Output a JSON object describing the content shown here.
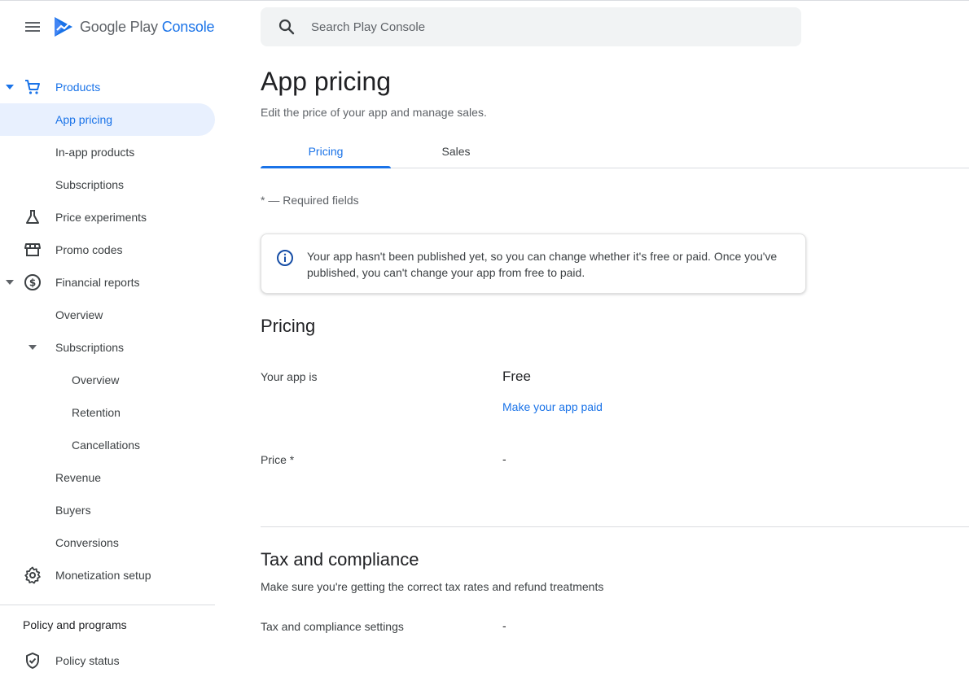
{
  "header": {
    "brand_google_play": "Google Play",
    "brand_console": "Console",
    "search_placeholder": "Search Play Console"
  },
  "sidebar": {
    "items": [
      {
        "label": "Products"
      },
      {
        "label": "App pricing"
      },
      {
        "label": "In-app products"
      },
      {
        "label": "Subscriptions"
      },
      {
        "label": "Price experiments"
      },
      {
        "label": "Promo codes"
      },
      {
        "label": "Financial reports"
      },
      {
        "label": "Overview"
      },
      {
        "label": "Subscriptions"
      },
      {
        "label": "Overview"
      },
      {
        "label": "Retention"
      },
      {
        "label": "Cancellations"
      },
      {
        "label": "Revenue"
      },
      {
        "label": "Buyers"
      },
      {
        "label": "Conversions"
      },
      {
        "label": "Monetization setup"
      }
    ],
    "section_title": "Policy and programs",
    "policy_items": [
      {
        "label": "Policy status"
      }
    ]
  },
  "main": {
    "title": "App pricing",
    "subtitle": "Edit the price of your app and manage sales.",
    "tabs": [
      {
        "label": "Pricing"
      },
      {
        "label": "Sales"
      }
    ],
    "required_note": "* — Required fields",
    "notice": "Your app hasn't been published yet, so you can change whether it's free or paid. Once you've published, you can't change your app from free to paid.",
    "pricing": {
      "heading": "Pricing",
      "your_app_label": "Your app is",
      "your_app_value": "Free",
      "make_paid_link": "Make your app paid",
      "price_label": "Price  *",
      "price_value": "-"
    },
    "tax": {
      "heading": "Tax and compliance",
      "description": "Make sure you're getting the correct tax rates and refund treatments",
      "settings_label": "Tax and compliance settings",
      "settings_value": "-"
    }
  },
  "colors": {
    "accent": "#1a73e8",
    "selected_bg": "#e8f0fe",
    "search_bg": "#f1f3f4",
    "divider": "#dadce0"
  },
  "icons": [
    "menu-icon",
    "play-console-logo",
    "search-icon",
    "cart-icon",
    "flask-icon",
    "store-icon",
    "dollar-icon",
    "gear-icon",
    "shield-icon",
    "info-icon",
    "caret-down-icon"
  ]
}
